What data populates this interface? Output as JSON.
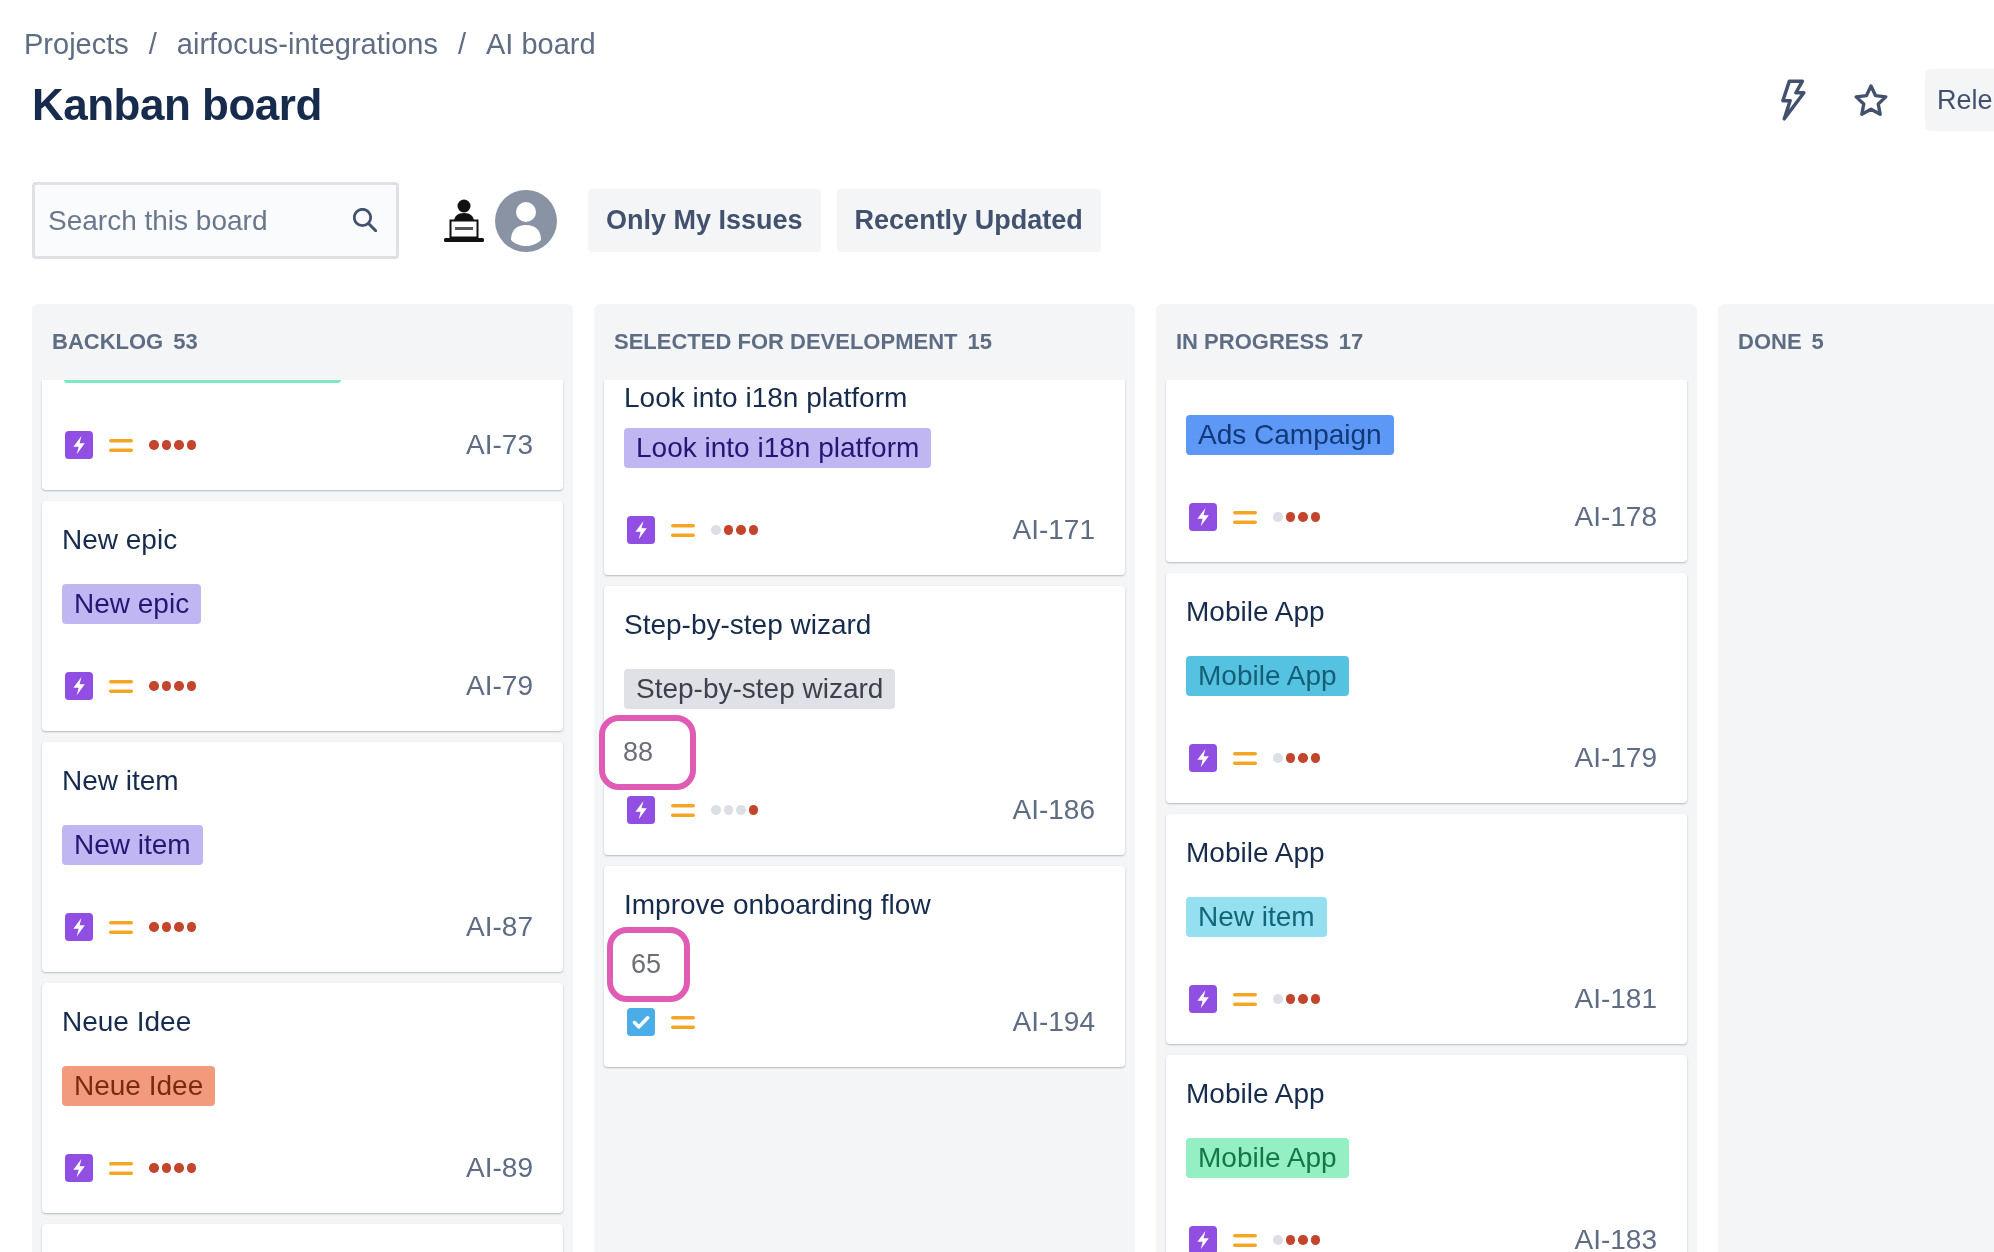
{
  "breadcrumbs": [
    {
      "label": "Projects",
      "separator": "/"
    },
    {
      "label": "airfocus-integrations",
      "separator": "/"
    },
    {
      "label": "AI board"
    }
  ],
  "page_title": "Kanban board",
  "header_button": "Rele",
  "search": {
    "placeholder": "Search this board"
  },
  "quick_filters": [
    {
      "label": "Only My Issues",
      "selected": false
    },
    {
      "label": "Recently Updated",
      "selected": false
    }
  ],
  "columns": [
    {
      "title": "BACKLOG",
      "count": "53",
      "more_cards_below": true,
      "cards": [
        {
          "label": {
            "color": "#7ee8c0"
          },
          "kind": "story",
          "stars": 4,
          "key": "AI-73"
        },
        {
          "title": "New epic",
          "label": {
            "text": "New epic",
            "color": "#c0b6f2"
          },
          "kind": "story",
          "stars": 4,
          "key": "AI-79"
        },
        {
          "title": "New item",
          "label": {
            "text": "New item",
            "color": "#c0b6f2"
          },
          "kind": "story",
          "stars": 4,
          "key": "AI-87"
        },
        {
          "title": "Neue Idee",
          "label": {
            "text": "Neue Idee",
            "color": "#f39a7c"
          },
          "kind": "story",
          "stars": 4,
          "key": "AI-89"
        }
      ]
    },
    {
      "title": "SELECTED FOR DEVELOPMENT",
      "count": "15",
      "cards": [
        {
          "title": "Look into i18n platform",
          "label": {
            "text": "Look into i18n platform",
            "color": "#c0b6f2"
          },
          "kind": "story",
          "stars": 3,
          "key": "AI-171"
        },
        {
          "title": "Step-by-step wizard",
          "label": {
            "text": "Step-by-step wizard",
            "color": "#dfe1e6"
          },
          "score": "88",
          "kind": "story",
          "stars": 1,
          "key": "AI-186"
        },
        {
          "title": "Improve onboarding flow",
          "score": "65",
          "kind": "task",
          "key": "AI-194"
        }
      ]
    },
    {
      "title": "IN PROGRESS",
      "count": "17",
      "cards": [
        {
          "label": {
            "text": "Ads Campaign",
            "color": "#5e98f7"
          },
          "kind": "story",
          "stars": 3,
          "key": "AI-178"
        },
        {
          "title": "Mobile App",
          "label": {
            "text": "Mobile App",
            "color": "#55c2e2"
          },
          "kind": "story",
          "stars": 3,
          "key": "AI-179"
        },
        {
          "title": "Mobile App",
          "label": {
            "text": "New item",
            "color": "#94e0f0"
          },
          "kind": "story",
          "stars": 3,
          "key": "AI-181"
        },
        {
          "title": "Mobile App",
          "label": {
            "text": "Mobile App",
            "color": "#94efc3"
          },
          "kind": "story",
          "stars": 3,
          "key": "AI-183"
        }
      ]
    },
    {
      "title": "DONE",
      "count": "5"
    }
  ]
}
